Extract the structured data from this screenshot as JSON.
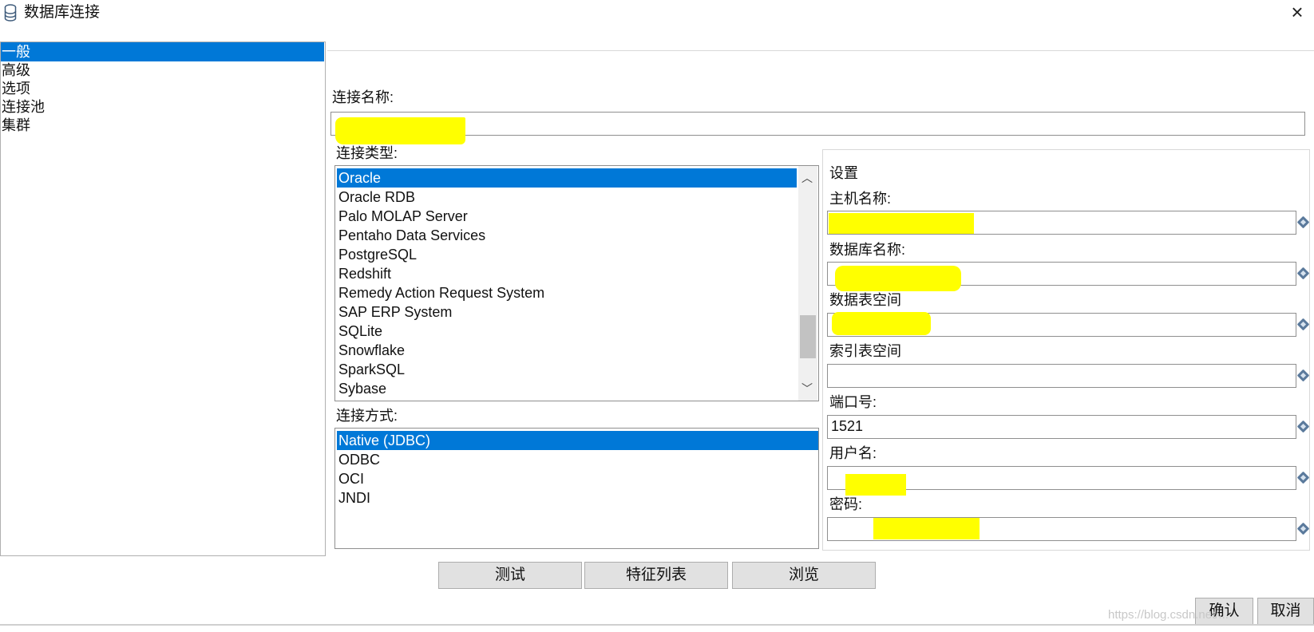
{
  "window": {
    "title": "数据库连接",
    "title_icon": "database-icon",
    "close_icon": "close-icon"
  },
  "nav": {
    "items": [
      {
        "label": "一般",
        "selected": true
      },
      {
        "label": "高级",
        "selected": false
      },
      {
        "label": "选项",
        "selected": false
      },
      {
        "label": "连接池",
        "selected": false
      },
      {
        "label": "集群",
        "selected": false
      }
    ]
  },
  "general": {
    "connection_name_label": "连接名称:",
    "connection_name_value": "",
    "connection_type_label": "连接类型:",
    "connection_types": [
      {
        "label": "Oracle",
        "selected": true
      },
      {
        "label": "Oracle RDB",
        "selected": false
      },
      {
        "label": "Palo MOLAP Server",
        "selected": false
      },
      {
        "label": "Pentaho Data Services",
        "selected": false
      },
      {
        "label": "PostgreSQL",
        "selected": false
      },
      {
        "label": "Redshift",
        "selected": false
      },
      {
        "label": "Remedy Action Request System",
        "selected": false
      },
      {
        "label": "SAP ERP System",
        "selected": false
      },
      {
        "label": "SQLite",
        "selected": false
      },
      {
        "label": "Snowflake",
        "selected": false
      },
      {
        "label": "SparkSQL",
        "selected": false
      },
      {
        "label": "Sybase",
        "selected": false
      }
    ],
    "access_label": "连接方式:",
    "access_methods": [
      {
        "label": "Native (JDBC)",
        "selected": true
      },
      {
        "label": "ODBC",
        "selected": false
      },
      {
        "label": "OCI",
        "selected": false
      },
      {
        "label": "JNDI",
        "selected": false
      }
    ]
  },
  "settings": {
    "title": "设置",
    "fields": [
      {
        "label": "主机名称:",
        "value": ""
      },
      {
        "label": "数据库名称:",
        "value": ""
      },
      {
        "label": "数据表空间",
        "value": ""
      },
      {
        "label": "索引表空间",
        "value": ""
      },
      {
        "label": "端口号:",
        "value": "1521"
      },
      {
        "label": "用户名:",
        "value": ""
      },
      {
        "label": "密码:",
        "value": ""
      }
    ],
    "variable_icon": "variable-diamond-icon",
    "highlight_color": "#ffff00"
  },
  "buttons": {
    "test": "测试",
    "features": "特征列表",
    "explore": "浏览",
    "ok": "确认",
    "cancel": "取消"
  },
  "colors": {
    "selection": "#0078d7",
    "button_bg": "#e1e1e1"
  },
  "watermark": "https://blog.csdn.net/..."
}
